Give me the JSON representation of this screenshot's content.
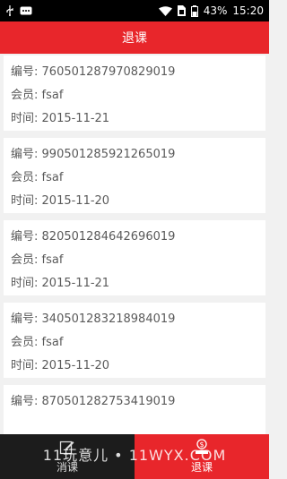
{
  "status_bar": {
    "battery": "43%",
    "time": "15:20",
    "icons": [
      "usb-icon",
      "message-icon",
      "wifi-icon",
      "sim-icon",
      "battery-icon"
    ]
  },
  "header": {
    "title": "退课"
  },
  "records": [
    {
      "number_label": "编号:",
      "number": "760501287970829019",
      "member_label": "会员:",
      "member": "fsaf",
      "time_label": "时间:",
      "time": "2015-11-21"
    },
    {
      "number_label": "编号:",
      "number": "990501285921265019",
      "member_label": "会员:",
      "member": "fsaf",
      "time_label": "时间:",
      "time": "2015-11-20"
    },
    {
      "number_label": "编号:",
      "number": "820501284642696019",
      "member_label": "会员:",
      "member": "fsaf",
      "time_label": "时间:",
      "time": "2015-11-21"
    },
    {
      "number_label": "编号:",
      "number": "340501283218984019",
      "member_label": "会员:",
      "member": "fsaf",
      "time_label": "时间:",
      "time": "2015-11-20"
    },
    {
      "number_label": "编号:",
      "number": "870501282753419019",
      "member_label": "",
      "member": "",
      "time_label": "",
      "time": ""
    }
  ],
  "bottom_nav": {
    "items": [
      {
        "label": "消课",
        "icon": "edit-icon"
      },
      {
        "label": "退课",
        "icon": "refund-icon"
      }
    ]
  },
  "watermark": "11玩意儿 • 11WYX.COM",
  "colors": {
    "accent": "#e8262b",
    "nav_dark": "#1c1c1c",
    "background": "#f1f1f1"
  }
}
